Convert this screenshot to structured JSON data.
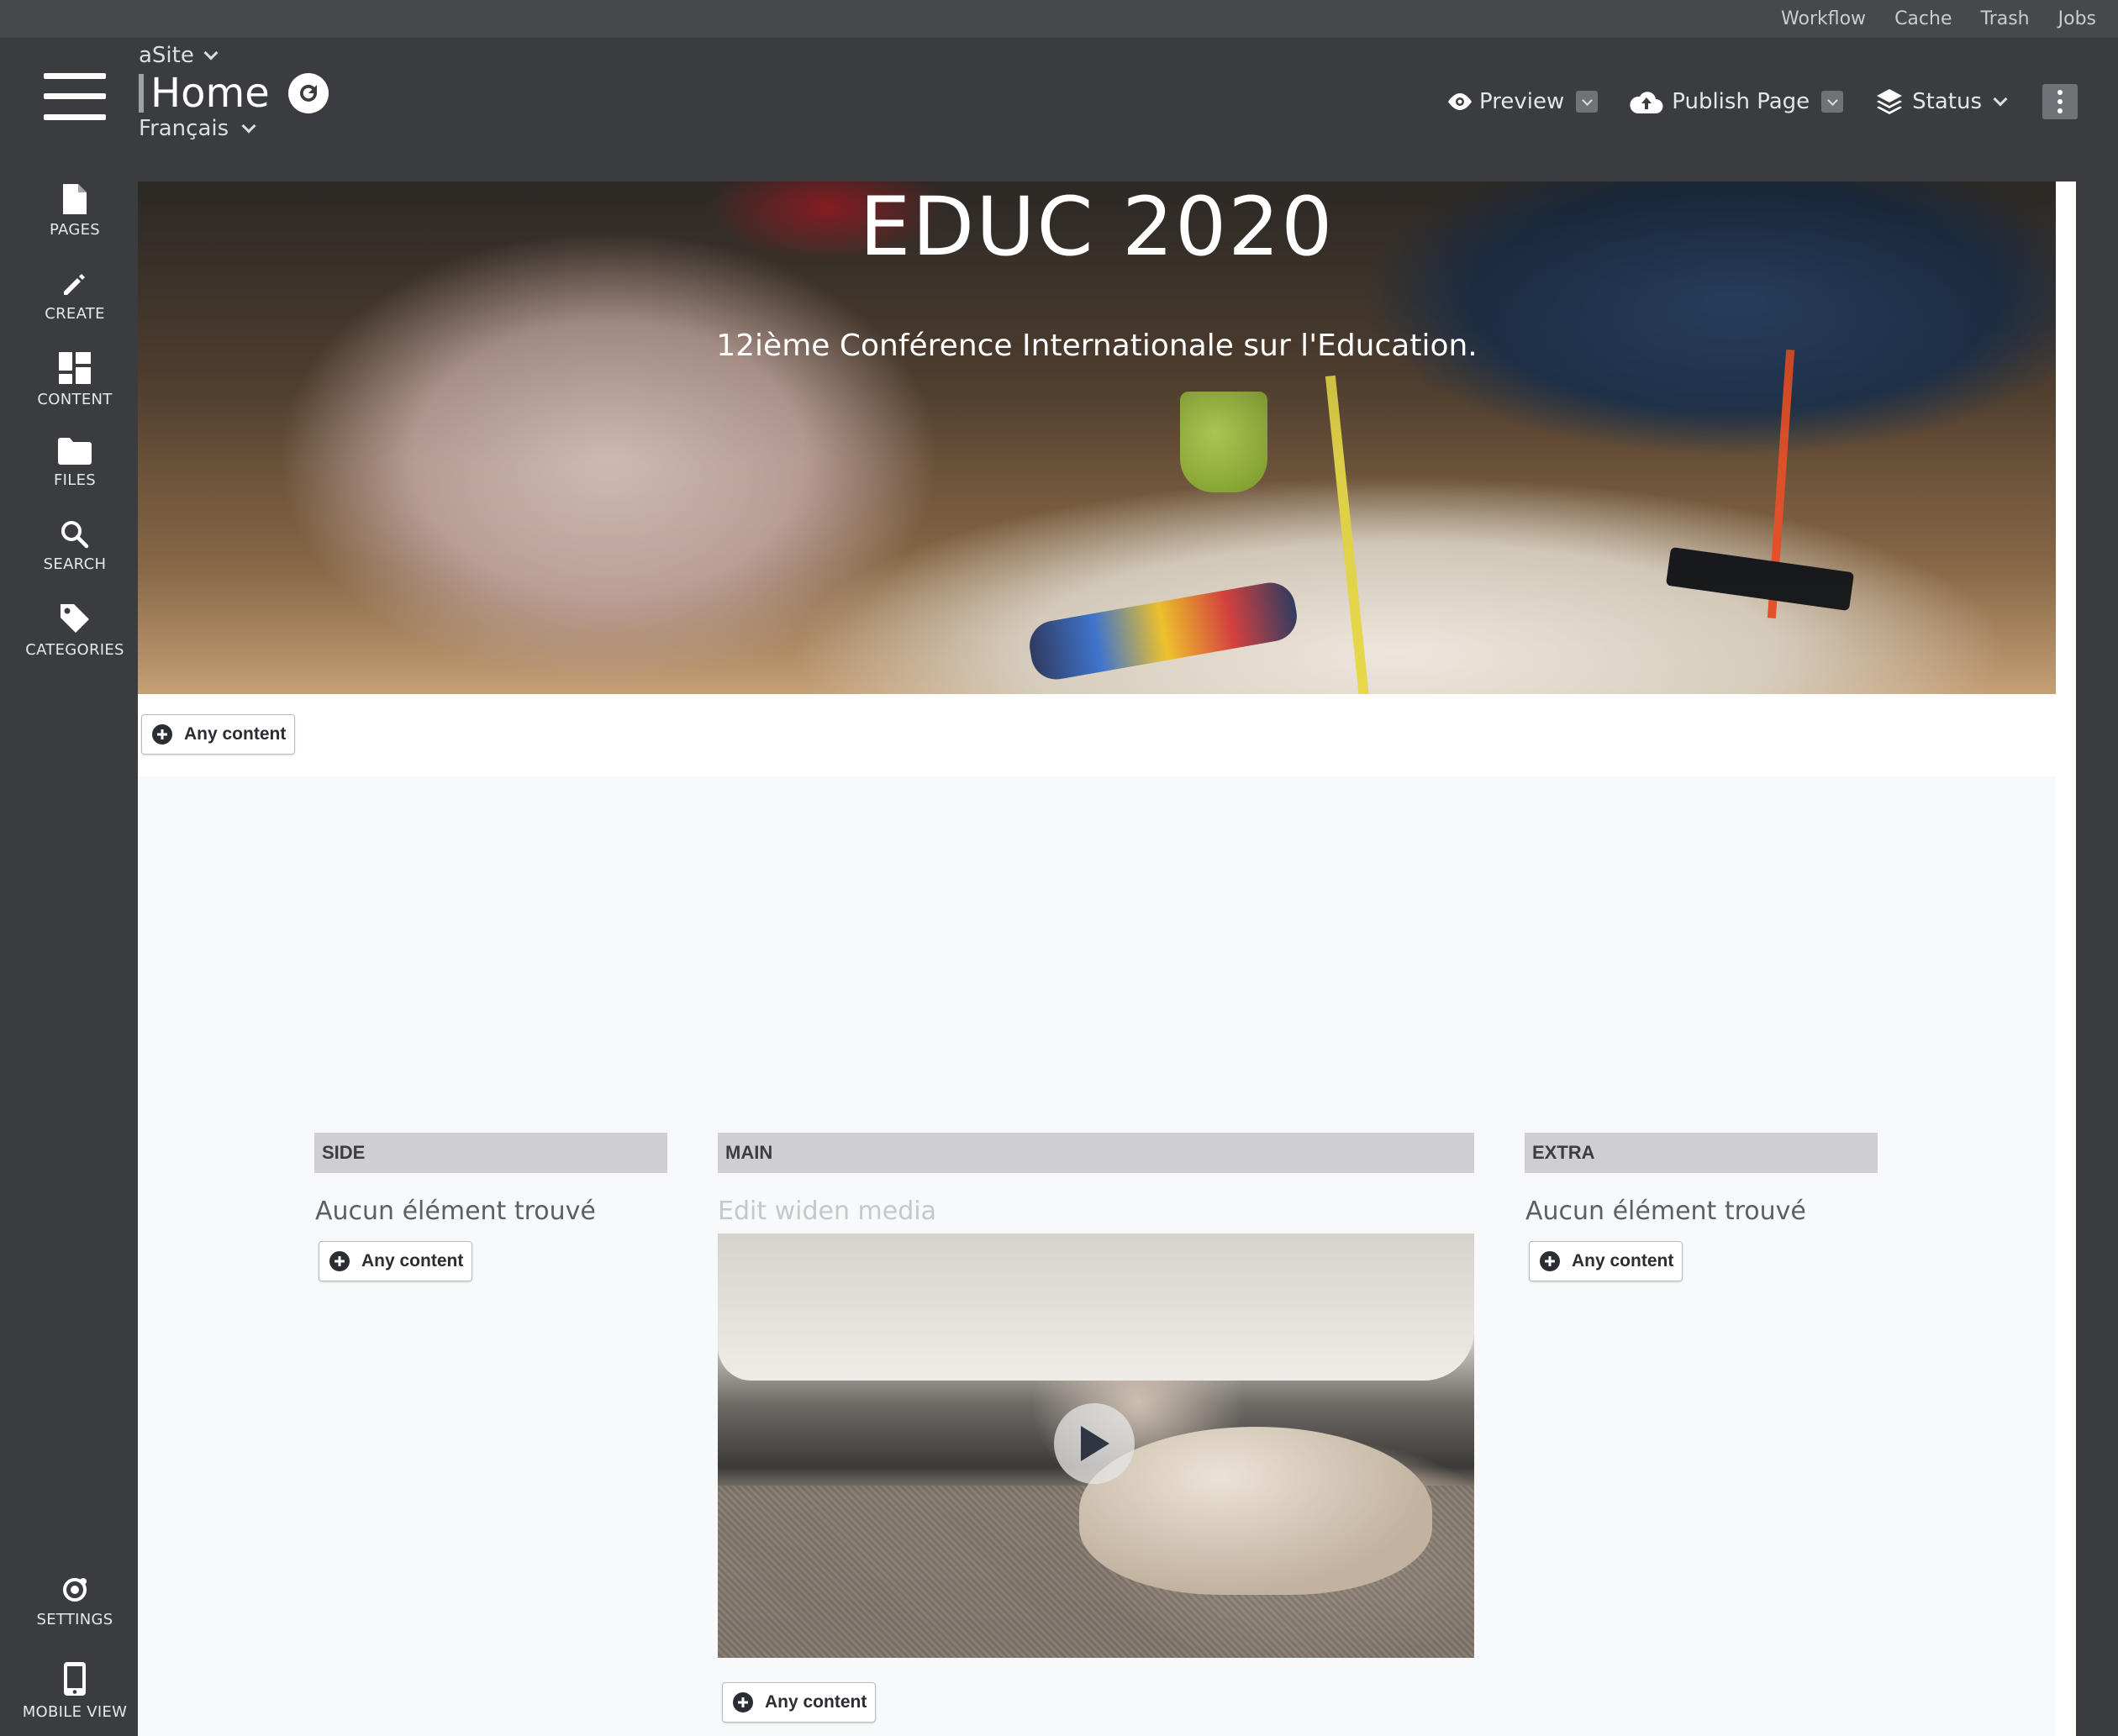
{
  "topbar": {
    "links": [
      "Workflow",
      "Cache",
      "Trash",
      "Jobs"
    ]
  },
  "header": {
    "site": "aSite",
    "page_title": "Home",
    "language": "Français",
    "actions": {
      "preview": "Preview",
      "publish": "Publish Page",
      "status": "Status"
    }
  },
  "sidebar": {
    "items": [
      {
        "label": "PAGES",
        "icon": "page-icon"
      },
      {
        "label": "CREATE",
        "icon": "pencil-icon"
      },
      {
        "label": "CONTENT",
        "icon": "grid-icon"
      },
      {
        "label": "FILES",
        "icon": "folder-icon"
      },
      {
        "label": "SEARCH",
        "icon": "search-icon"
      },
      {
        "label": "CATEGORIES",
        "icon": "tag-icon"
      }
    ],
    "bottom": [
      {
        "label": "SETTINGS",
        "icon": "settings-icon"
      },
      {
        "label": "MOBILE VIEW",
        "icon": "mobile-icon"
      }
    ]
  },
  "hero": {
    "title": "EDUC 2020",
    "subtitle": "12ième Conférence Internationale sur l'Education."
  },
  "add_content_label": "Any content",
  "columns": {
    "side": {
      "header": "SIDE",
      "empty": "Aucun élément trouvé"
    },
    "main": {
      "header": "MAIN",
      "edit_hint": "Edit widen media"
    },
    "extra": {
      "header": "EXTRA",
      "empty": "Aucun élément trouvé"
    }
  },
  "colors": {
    "chrome": "#3a3c40",
    "topbar": "#46484c",
    "section_bg": "#f7f9fb",
    "column_header": "#cfcfd1"
  }
}
